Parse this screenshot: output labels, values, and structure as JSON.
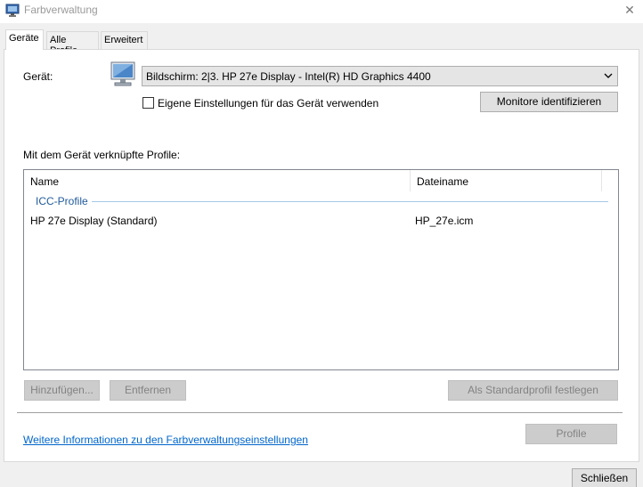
{
  "window": {
    "title": "Farbverwaltung",
    "close_glyph": "✕"
  },
  "tabs": [
    {
      "label": "Geräte",
      "active": true
    },
    {
      "label": "Alle Profile",
      "active": false
    },
    {
      "label": "Erweitert",
      "active": false
    }
  ],
  "device": {
    "label": "Gerät:",
    "selected": "Bildschirm: 2|3. HP 27e Display - Intel(R) HD Graphics 4400",
    "own_settings_label": "Eigene Einstellungen für das Gerät verwenden",
    "own_settings_checked": false,
    "identify_button": "Monitore identifizieren"
  },
  "profiles": {
    "section_label": "Mit dem Gerät verknüpfte Profile:",
    "columns": [
      "Name",
      "Dateiname"
    ],
    "group": "ICC-Profile",
    "rows": [
      {
        "name": "HP 27e Display (Standard)",
        "file": "HP_27e.icm"
      }
    ]
  },
  "buttons": {
    "add": "Hinzufügen...",
    "remove": "Entfernen",
    "set_default": "Als Standardprofil festlegen",
    "profile": "Profile",
    "close": "Schließen"
  },
  "link": "Weitere Informationen zu den Farbverwaltungseinstellungen",
  "colors": {
    "link": "#0066cc",
    "group_label": "#1f5a9a"
  }
}
